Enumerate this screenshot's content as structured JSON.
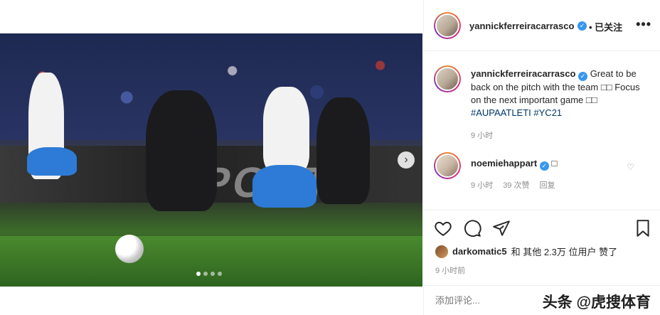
{
  "post": {
    "author": "yannickferreiracarrasco",
    "follow_label": "• 已关注",
    "more_label": "•••",
    "caption_author": "yannickferreiracarrasco",
    "caption_line1": "Great to be back on the pitch with the team",
    "caption_emoji1": "□□",
    "caption_line2": "Focus on the next important game",
    "caption_emoji2": "□□",
    "hashtag1": "#AUPAATLETI",
    "hashtag2": "#YC21",
    "caption_time": "9 小时"
  },
  "comments": [
    {
      "author": "noemiehappart",
      "text": "□",
      "time": "9 小时",
      "likes": "39 次赞",
      "reply": "回复"
    }
  ],
  "likes": {
    "liker": "darkomatic5",
    "rest": "和 其他 2.3万 位用户 赞了"
  },
  "posted_time": "9 小时前",
  "comment_placeholder": "添加评论...",
  "watermark": "头条 @虎搜体育",
  "media": {
    "board_text": "SPORT",
    "next_icon": "›",
    "carousel_count": 4,
    "carousel_active": 1
  },
  "icons": {
    "heart": "heart-icon",
    "comment": "comment-icon",
    "share": "share-icon",
    "save": "bookmark-icon",
    "verified": "verified-icon"
  },
  "colors": {
    "verified": "#3897f0",
    "hashtag": "#00376b",
    "meta": "#8e8e8e"
  }
}
